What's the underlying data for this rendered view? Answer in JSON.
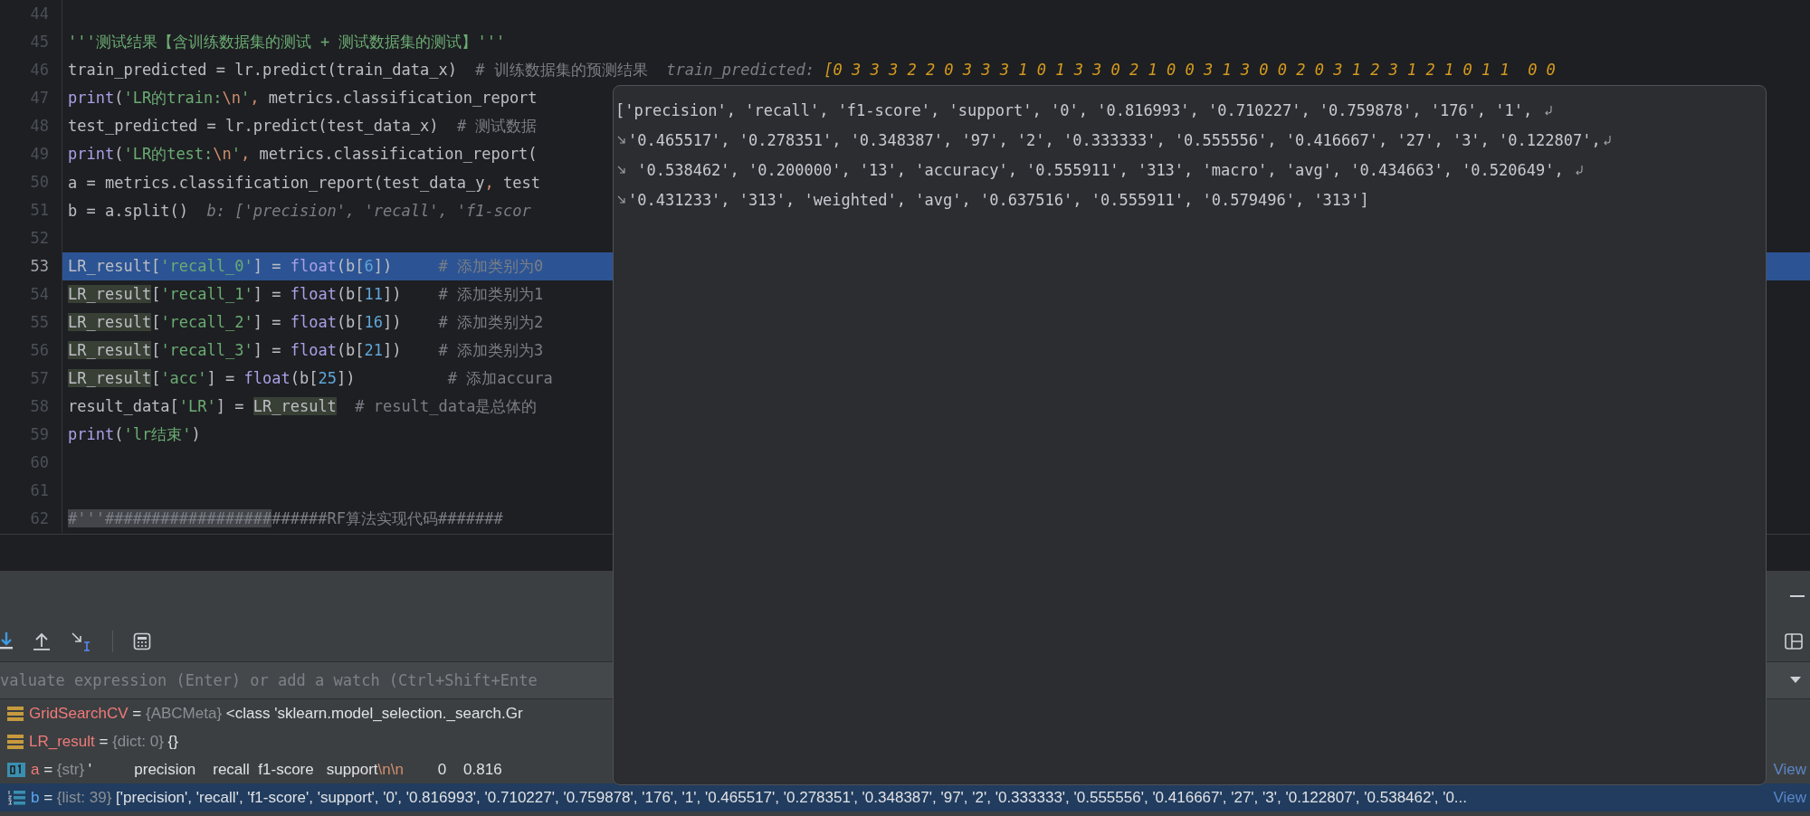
{
  "editor": {
    "lines": [
      {
        "number": "44",
        "selected": false
      },
      {
        "number": "45",
        "selected": false,
        "tokens": [
          {
            "kind": "string",
            "s": "'''测试结果【含训练数据集的测试 + 测试数据集的测试】'''"
          }
        ]
      },
      {
        "number": "46",
        "selected": false,
        "tokens": [
          {
            "kind": "plain",
            "s": "train_predicted = lr.predict(train_data_x)  "
          },
          {
            "kind": "comment",
            "s": "# 训练数据集的预测结果  "
          },
          {
            "kind": "hint",
            "s": "train_predicted: "
          },
          {
            "kind": "hint_value",
            "s": "[0 3 3 3 2 2 0 3 3 3 1 0 1 3 3 0 2 1 0 0 3 1 3 0 0 2 0 3 1 2 3 1 2 1 0 1 1  0 0"
          }
        ]
      },
      {
        "number": "47",
        "selected": false,
        "tokens": [
          {
            "kind": "keyword",
            "s": "print"
          },
          {
            "kind": "plain",
            "s": "("
          },
          {
            "kind": "string",
            "s": "'LR的train:"
          },
          {
            "kind": "escape",
            "s": "\\n"
          },
          {
            "kind": "string",
            "s": "'"
          },
          {
            "kind": "escape",
            "s": ", "
          },
          {
            "kind": "plain",
            "s": "metrics.classification_report"
          }
        ]
      },
      {
        "number": "48",
        "selected": false,
        "tokens": [
          {
            "kind": "plain",
            "s": "test_predicted = lr.predict(test_data_x)  "
          },
          {
            "kind": "comment",
            "s": "# 测试数据"
          }
        ]
      },
      {
        "number": "49",
        "selected": false,
        "tokens": [
          {
            "kind": "keyword",
            "s": "print"
          },
          {
            "kind": "plain",
            "s": "("
          },
          {
            "kind": "string",
            "s": "'LR的test:"
          },
          {
            "kind": "escape",
            "s": "\\n"
          },
          {
            "kind": "string",
            "s": "'"
          },
          {
            "kind": "escape",
            "s": ", "
          },
          {
            "kind": "plain",
            "s": "metrics.classification_report("
          }
        ]
      },
      {
        "number": "50",
        "selected": false,
        "tokens": [
          {
            "kind": "plain",
            "s": "a = metrics.classification_report(test_data_y"
          },
          {
            "kind": "escape",
            "s": ", "
          },
          {
            "kind": "plain",
            "s": "test"
          }
        ]
      },
      {
        "number": "51",
        "selected": false,
        "tokens": [
          {
            "kind": "plain",
            "s": "b = a.split()  "
          },
          {
            "kind": "hint",
            "s": "b: ['precision', 'recall', 'f1-scor"
          }
        ]
      },
      {
        "number": "52",
        "selected": false
      },
      {
        "number": "53",
        "selected": true,
        "tokens": [
          {
            "kind": "plain",
            "s": "LR_result["
          },
          {
            "kind": "string",
            "s": "'recall_0'"
          },
          {
            "kind": "plain",
            "s": "] = "
          },
          {
            "kind": "keyword",
            "s": "float"
          },
          {
            "kind": "plain",
            "s": "(b["
          },
          {
            "kind": "number",
            "s": "6"
          },
          {
            "kind": "plain",
            "s": "])     "
          },
          {
            "kind": "comment",
            "s": "# 添加类别为0"
          }
        ]
      },
      {
        "number": "54",
        "selected": false,
        "tokens": [
          {
            "kind": "ref",
            "s": "LR_result"
          },
          {
            "kind": "plain",
            "s": "["
          },
          {
            "kind": "string",
            "s": "'recall_1'"
          },
          {
            "kind": "plain",
            "s": "] = "
          },
          {
            "kind": "keyword",
            "s": "float"
          },
          {
            "kind": "plain",
            "s": "(b["
          },
          {
            "kind": "number",
            "s": "11"
          },
          {
            "kind": "plain",
            "s": "])    "
          },
          {
            "kind": "comment",
            "s": "# 添加类别为1"
          }
        ]
      },
      {
        "number": "55",
        "selected": false,
        "tokens": [
          {
            "kind": "ref",
            "s": "LR_result"
          },
          {
            "kind": "plain",
            "s": "["
          },
          {
            "kind": "string",
            "s": "'recall_2'"
          },
          {
            "kind": "plain",
            "s": "] = "
          },
          {
            "kind": "keyword",
            "s": "float"
          },
          {
            "kind": "plain",
            "s": "(b["
          },
          {
            "kind": "number",
            "s": "16"
          },
          {
            "kind": "plain",
            "s": "])    "
          },
          {
            "kind": "comment",
            "s": "# 添加类别为2"
          }
        ]
      },
      {
        "number": "56",
        "selected": false,
        "tokens": [
          {
            "kind": "ref",
            "s": "LR_result"
          },
          {
            "kind": "plain",
            "s": "["
          },
          {
            "kind": "string",
            "s": "'recall_3'"
          },
          {
            "kind": "plain",
            "s": "] = "
          },
          {
            "kind": "keyword",
            "s": "float"
          },
          {
            "kind": "plain",
            "s": "(b["
          },
          {
            "kind": "number",
            "s": "21"
          },
          {
            "kind": "plain",
            "s": "])    "
          },
          {
            "kind": "comment",
            "s": "# 添加类别为3"
          }
        ]
      },
      {
        "number": "57",
        "selected": false,
        "tokens": [
          {
            "kind": "ref",
            "s": "LR_result"
          },
          {
            "kind": "plain",
            "s": "["
          },
          {
            "kind": "string",
            "s": "'acc'"
          },
          {
            "kind": "plain",
            "s": "] = "
          },
          {
            "kind": "keyword",
            "s": "float"
          },
          {
            "kind": "plain",
            "s": "(b["
          },
          {
            "kind": "number",
            "s": "25"
          },
          {
            "kind": "plain",
            "s": "])          "
          },
          {
            "kind": "comment",
            "s": "# 添加accura"
          }
        ]
      },
      {
        "number": "58",
        "selected": false,
        "tokens": [
          {
            "kind": "plain",
            "s": "result_data["
          },
          {
            "kind": "string",
            "s": "'LR'"
          },
          {
            "kind": "plain",
            "s": "] = "
          },
          {
            "kind": "ref",
            "s": "LR_result"
          },
          {
            "kind": "comment",
            "s": "  # result_data是总体的"
          }
        ]
      },
      {
        "number": "59",
        "selected": false,
        "tokens": [
          {
            "kind": "keyword",
            "s": "print"
          },
          {
            "kind": "plain",
            "s": "("
          },
          {
            "kind": "string",
            "s": "'lr结束'"
          },
          {
            "kind": "plain",
            "s": ")"
          }
        ]
      },
      {
        "number": "60",
        "selected": false
      },
      {
        "number": "61",
        "selected": false
      },
      {
        "number": "62",
        "selected": false,
        "tokens": [
          {
            "kind": "marked",
            "s": "#'''##################"
          },
          {
            "kind": "comment",
            "s": "######RF算法实现代码#######"
          }
        ]
      }
    ]
  },
  "debugger": {
    "evaluate": {
      "placeholder": "valuate expression (Enter) or add a watch (Ctrl+Shift+Ente"
    },
    "variables": [
      {
        "kind": "field",
        "name": "GridSearchCV",
        "operator": "=",
        "type": "{ABCMeta}",
        "selected": false,
        "value": [
          {
            "kind": "plain",
            "s": " <class 'sklearn.model_selection._search.Gr"
          }
        ]
      },
      {
        "kind": "field",
        "name": "LR_result",
        "operator": "=",
        "type": "{dict: 0}",
        "selected": false,
        "value": [
          {
            "kind": "plain",
            "s": " {}"
          }
        ]
      },
      {
        "kind": "string",
        "name": "a",
        "operator": "=",
        "type": "{str}",
        "selected": false,
        "value": [
          {
            "kind": "plain",
            "s": " '          precision    recall  f1-score   support"
          },
          {
            "kind": "escape",
            "s": "\\n\\n"
          },
          {
            "kind": "plain",
            "s": "        0    0.816"
          }
        ],
        "link": "View"
      },
      {
        "kind": "list",
        "name": "b",
        "operator": "=",
        "type": "{list: 39}",
        "selected": true,
        "value": [
          {
            "kind": "plain",
            "s": " ['precision', 'recall', 'f1-score', 'support', '0', '0.816993', '0.710227', '0.759878', '176', '1', '0.465517', '0.278351', '0.348387', '97', '2', '0.333333', '0.555556', '0.416667', '27', '3', '0.122807', '0.538462', '0..."
          }
        ],
        "link": "View"
      }
    ]
  },
  "popup": {
    "lines": [
      {
        "text": "['precision', 'recall', 'f1-score', 'support', '0', '0.816993', '0.710227', '0.759878', '176', '1', ",
        "wrap_start": false,
        "wrap_end": true
      },
      {
        "text": "'0.465517', '0.278351', '0.348387', '97', '2', '0.333333', '0.555556', '0.416667', '27', '3', '0.122807',",
        "wrap_start": true,
        "wrap_end": true
      },
      {
        "text": " '0.538462', '0.200000', '13', 'accuracy', '0.555911', '313', 'macro', 'avg', '0.434663', '0.520649', ",
        "wrap_start": true,
        "wrap_end": true
      },
      {
        "text": "'0.431233', '313', 'weighted', 'avg', '0.637516', '0.555911', '0.579496', '313']",
        "wrap_start": true,
        "wrap_end": false
      }
    ]
  }
}
